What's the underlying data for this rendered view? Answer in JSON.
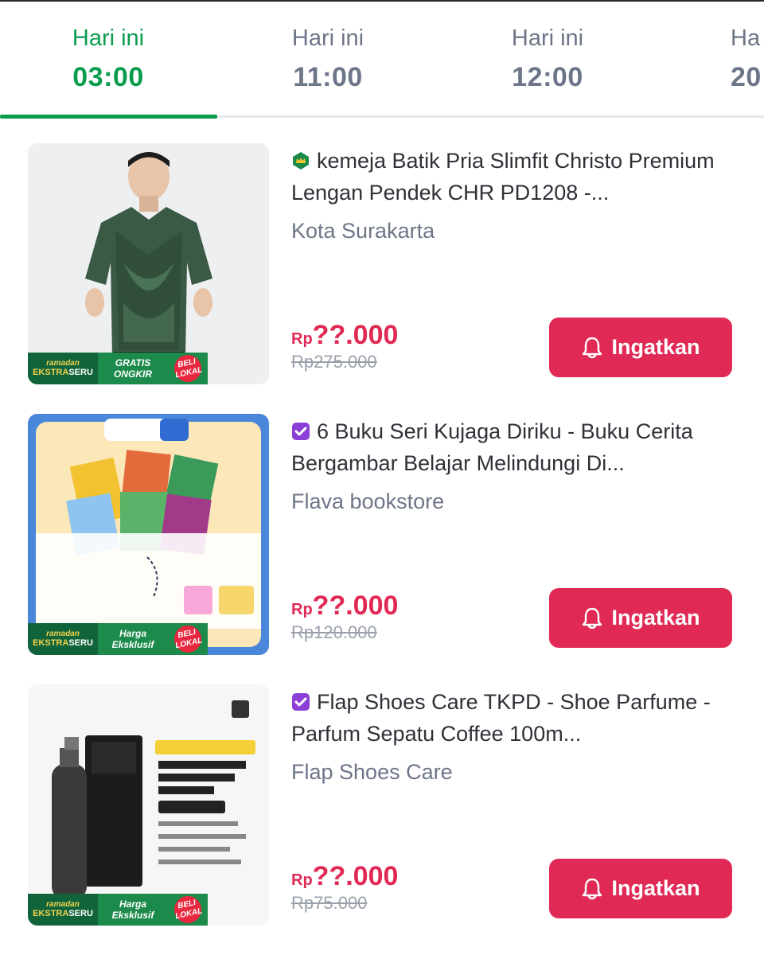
{
  "tabs": [
    {
      "day": "Hari ini",
      "time": "03:00",
      "active": true
    },
    {
      "day": "Hari ini",
      "time": "11:00",
      "active": false
    },
    {
      "day": "Hari ini",
      "time": "12:00",
      "active": false
    },
    {
      "day": "Ha",
      "time": "20",
      "active": false
    }
  ],
  "badges": {
    "ramadan_top": "ramadan",
    "ramadan_bottom_a": "EKSTRA",
    "ramadan_bottom_b": "SERU",
    "gratis_1": "GRATIS",
    "gratis_2": "ONGKIR",
    "harga_1": "Harga",
    "harga_2": "Eksklusif",
    "lokal": "BELI LOKAL"
  },
  "products": [
    {
      "title": "kemeja Batik Pria Slimfit Christo Premium Lengan Pendek CHR PD1208 -...",
      "shop_badge": "crown-icon",
      "shop": "Kota Surakarta",
      "price_currency": "Rp",
      "price": "??.000",
      "original_price": "Rp275.000",
      "button": "Ingatkan"
    },
    {
      "title": "6 Buku Seri Kujaga Diriku - Buku Cerita Bergambar Belajar Melindungi Di...",
      "shop_badge": "verified-icon",
      "shop": "Flava bookstore",
      "price_currency": "Rp",
      "price": "??.000",
      "original_price": "Rp120.000",
      "button": "Ingatkan"
    },
    {
      "title": "Flap Shoes Care TKPD - Shoe Parfume - Parfum Sepatu Coffee 100m...",
      "shop_badge": "verified-icon",
      "shop": "Flap Shoes Care",
      "price_currency": "Rp",
      "price": "??.000",
      "original_price": "Rp75.000",
      "button": "Ingatkan"
    }
  ],
  "colors": {
    "accent_green": "#0a9c4f",
    "price_red": "#e02954",
    "muted": "#6d7588",
    "verified_purple": "#8b3fd6",
    "crown_green": "#1b8a4a"
  }
}
